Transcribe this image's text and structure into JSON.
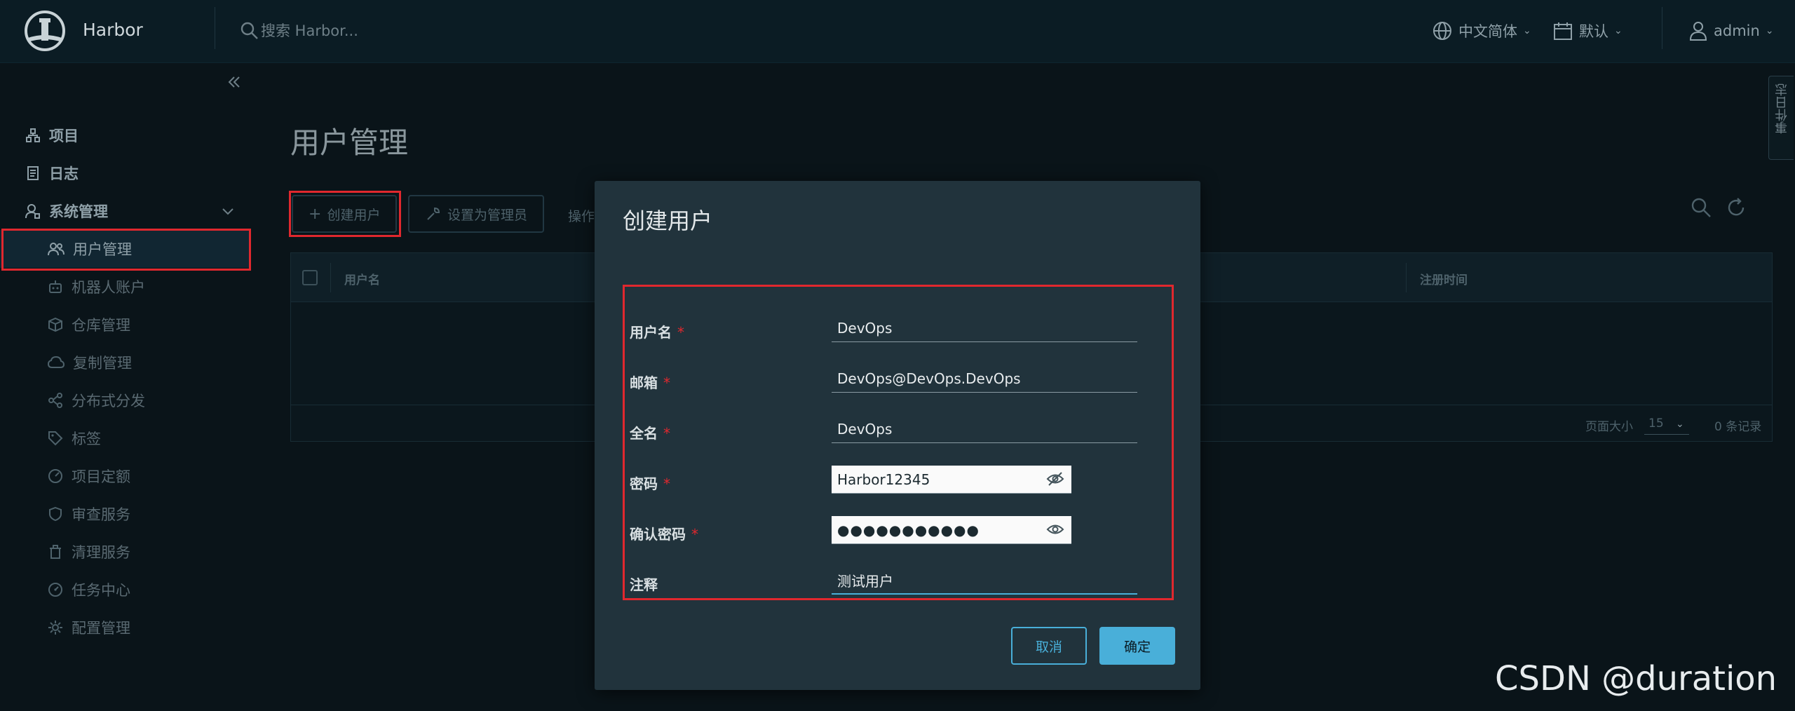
{
  "header": {
    "brand": "Harbor",
    "search_placeholder": "搜索 Harbor...",
    "language": "中文简体",
    "datetime_format": "默认",
    "user": "admin"
  },
  "sidebar": {
    "projects": "项目",
    "logs": "日志",
    "admin": "系统管理",
    "items": [
      "用户管理",
      "机器人账户",
      "仓库管理",
      "复制管理",
      "分布式分发",
      "标签",
      "项目定额",
      "审查服务",
      "清理服务",
      "任务中心",
      "配置管理"
    ]
  },
  "page": {
    "title": "用户管理",
    "create_user": "创建用户",
    "set_admin": "设置为管理员",
    "actions": "操作",
    "columns": [
      "用户名",
      "注册时间"
    ],
    "page_size_label": "页面大小",
    "page_size": "15",
    "total": "0 条记录"
  },
  "modal": {
    "title": "创建用户",
    "fields": {
      "username": {
        "label": "用户名",
        "value": "DevOps"
      },
      "email": {
        "label": "邮箱",
        "value": "DevOps@DevOps.DevOps"
      },
      "fullname": {
        "label": "全名",
        "value": "DevOps"
      },
      "password": {
        "label": "密码",
        "value": "Harbor12345"
      },
      "confirm": {
        "label": "确认密码",
        "value": "●●●●●●●●●●●"
      },
      "comment": {
        "label": "注释",
        "value": "测试用户"
      }
    },
    "required_mark": "*",
    "cancel": "取消",
    "ok": "确定"
  },
  "side_tab": "事件日志",
  "watermark": "CSDN @duration ~",
  "colors": {
    "accent": "#49afd9",
    "required": "#e0282e",
    "highlight": "#e0282e"
  }
}
